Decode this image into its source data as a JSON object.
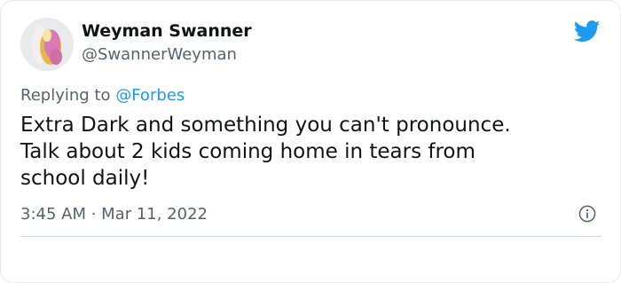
{
  "author": {
    "name": "Weyman Swanner",
    "handle": "@SwannerWeyman",
    "avatar_icon": "moth-avatar"
  },
  "reply": {
    "prefix": "Replying to",
    "target": "@Forbes"
  },
  "tweet": {
    "lines": [
      "Extra Dark and something you can't pronounce.",
      "Talk about 2 kids coming home in tears from",
      "school daily!"
    ]
  },
  "meta": {
    "timestamp": "3:45 AM · Mar 11, 2022"
  },
  "icons": {
    "brand": "twitter-bird-icon",
    "info": "info-icon"
  },
  "colors": {
    "brand": "#1d9bf0",
    "text": "#0f1419",
    "secondary": "#536471"
  }
}
